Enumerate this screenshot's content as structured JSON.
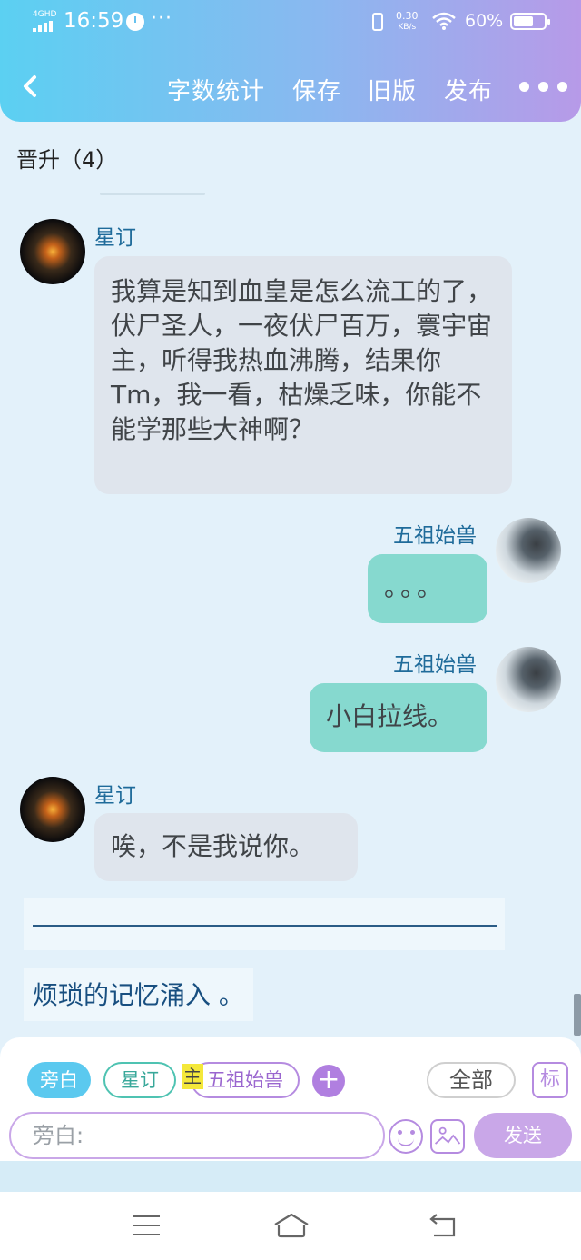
{
  "status_bar": {
    "network": "4GHD",
    "time": "16:59",
    "extra": "···",
    "speed_value": "0.30",
    "speed_unit": "KB/s",
    "battery": "60%"
  },
  "toolbar": {
    "word_count": "字数统计",
    "save": "保存",
    "old_version": "旧版",
    "publish": "发布"
  },
  "chapter_title": "晋升（4）",
  "messages": [
    {
      "speaker": "星订",
      "side": "left",
      "text": "我算是知到血皇是怎么流工的了，伏尸圣人，一夜伏尸百万，寰宇宙主，听得我热血沸腾，结果你Tm，我一看，枯燥乏味，你能不能学那些大神啊？"
    },
    {
      "speaker": "五祖始兽",
      "side": "right",
      "text": "。。。"
    },
    {
      "speaker": "五祖始兽",
      "side": "right",
      "text": "小白拉线。"
    },
    {
      "speaker": "星订",
      "side": "left",
      "text": "唉，不是我说你。"
    }
  ],
  "narration": "烦琐的记忆涌入 。",
  "input_panel": {
    "roles": [
      "旁白",
      "星订",
      "五祖始兽"
    ],
    "main_marker": "主",
    "add_label": "+",
    "all_label": "全部",
    "tag_label": "标",
    "placeholder": "旁白:",
    "send_label": "发送"
  },
  "colors": {
    "header_start": "#5bd0f2",
    "header_end": "#b79ae8",
    "bubble_left": "#dfe5ed",
    "bubble_right": "#86d9cf",
    "accent_purple": "#b58be0",
    "accent_teal": "#4fc3b2"
  },
  "icons": [
    "back-icon",
    "alarm-icon",
    "vibrate-icon",
    "wifi-icon",
    "battery-icon",
    "more-icon",
    "emoji-icon",
    "image-icon",
    "menu-icon",
    "home-icon",
    "return-icon"
  ]
}
